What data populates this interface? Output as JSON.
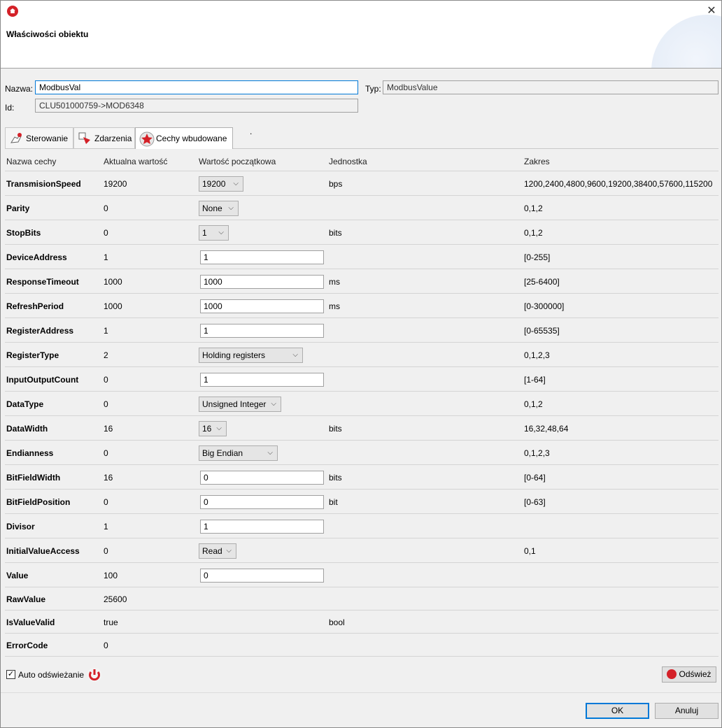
{
  "window": {
    "title": "Właściwości obiektu"
  },
  "form": {
    "name_label": "Nazwa:",
    "name_value": "ModbusVal",
    "type_label": "Typ:",
    "type_value": "ModbusValue",
    "id_label": "Id:",
    "id_value": "CLU501000759->MOD6348"
  },
  "tabs": [
    {
      "label": "Sterowanie",
      "icon": "hand-pointer-icon",
      "active": false
    },
    {
      "label": "Zdarzenia",
      "icon": "events-icon",
      "active": false
    },
    {
      "label": "Cechy wbudowane",
      "icon": "star-icon",
      "active": true
    }
  ],
  "tab_dot": ".",
  "grid": {
    "headers": [
      "Nazwa cechy",
      "Aktualna wartość",
      "Wartość początkowa",
      "Jednostka",
      "Zakres"
    ],
    "rows": [
      {
        "name": "TransmisionSpeed",
        "current": "19200",
        "initial": "19200",
        "kind": "select",
        "unit": "bps",
        "range": "1200,2400,4800,9600,19200,38400,57600,115200"
      },
      {
        "name": "Parity",
        "current": "0",
        "initial": "None",
        "kind": "select",
        "unit": "",
        "range": "0,1,2"
      },
      {
        "name": "StopBits",
        "current": "0",
        "initial": "1",
        "kind": "select",
        "unit": "bits",
        "range": "0,1,2"
      },
      {
        "name": "DeviceAddress",
        "current": "1",
        "initial": "1",
        "kind": "input",
        "unit": "",
        "range": "[0-255]"
      },
      {
        "name": "ResponseTimeout",
        "current": "1000",
        "initial": "1000",
        "kind": "input",
        "unit": "ms",
        "range": "[25-6400]"
      },
      {
        "name": "RefreshPeriod",
        "current": "1000",
        "initial": "1000",
        "kind": "input",
        "unit": "ms",
        "range": "[0-300000]"
      },
      {
        "name": "RegisterAddress",
        "current": "1",
        "initial": "1",
        "kind": "input",
        "unit": "",
        "range": "[0-65535]"
      },
      {
        "name": "RegisterType",
        "current": "2",
        "initial": "Holding registers",
        "kind": "select",
        "unit": "",
        "range": "0,1,2,3"
      },
      {
        "name": "InputOutputCount",
        "current": "0",
        "initial": "1",
        "kind": "input",
        "unit": "",
        "range": "[1-64]"
      },
      {
        "name": "DataType",
        "current": "0",
        "initial": "Unsigned Integer",
        "kind": "select",
        "unit": "",
        "range": "0,1,2"
      },
      {
        "name": "DataWidth",
        "current": "16",
        "initial": "16",
        "kind": "select",
        "unit": "bits",
        "range": "16,32,48,64"
      },
      {
        "name": "Endianness",
        "current": "0",
        "initial": "Big Endian",
        "kind": "select",
        "unit": "",
        "range": "0,1,2,3"
      },
      {
        "name": "BitFieldWidth",
        "current": "16",
        "initial": "0",
        "kind": "input",
        "unit": "bits",
        "range": "[0-64]"
      },
      {
        "name": "BitFieldPosition",
        "current": "0",
        "initial": "0",
        "kind": "input",
        "unit": "bit",
        "range": "[0-63]"
      },
      {
        "name": "Divisor",
        "current": "1",
        "initial": "1",
        "kind": "input",
        "unit": "",
        "range": ""
      },
      {
        "name": "InitialValueAccess",
        "current": "0",
        "initial": "Read",
        "kind": "select",
        "unit": "",
        "range": "0,1"
      },
      {
        "name": "Value",
        "current": "100",
        "initial": "0",
        "kind": "input",
        "unit": "",
        "range": ""
      },
      {
        "name": "RawValue",
        "current": "25600",
        "initial": "",
        "kind": "none",
        "unit": "",
        "range": ""
      },
      {
        "name": "IsValueValid",
        "current": "true",
        "initial": "",
        "kind": "none",
        "unit": "bool",
        "range": ""
      },
      {
        "name": "ErrorCode",
        "current": "0",
        "initial": "",
        "kind": "none",
        "unit": "",
        "range": ""
      }
    ]
  },
  "footer": {
    "auto_refresh_label": "Auto odświeżanie",
    "auto_refresh_checked": true,
    "refresh_button": "Odśwież",
    "ok_button": "OK",
    "cancel_button": "Anuluj"
  },
  "colors": {
    "accent": "#0078d7",
    "brand": "#d42128"
  }
}
